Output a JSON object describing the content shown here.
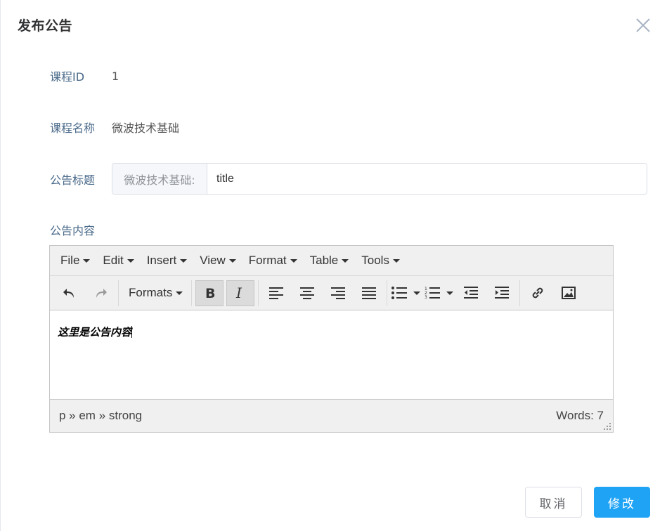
{
  "dialog": {
    "title": "发布公告",
    "close_icon": "close-icon"
  },
  "form": {
    "course_id": {
      "label": "课程ID",
      "value": "1"
    },
    "course_name": {
      "label": "课程名称",
      "value": "微波技术基础"
    },
    "notice_title": {
      "label": "公告标题",
      "prepend": "微波技术基础:",
      "value": "title"
    },
    "notice_content": {
      "label": "公告内容"
    }
  },
  "editor": {
    "menubar": [
      "File",
      "Edit",
      "Insert",
      "View",
      "Format",
      "Table",
      "Tools"
    ],
    "toolbar": {
      "formats_label": "Formats",
      "icons": [
        "undo-icon",
        "redo-icon",
        "bold-icon",
        "italic-icon",
        "align-left-icon",
        "align-center-icon",
        "align-right-icon",
        "align-justify-icon",
        "bullet-list-icon",
        "numbered-list-icon",
        "outdent-icon",
        "indent-icon",
        "link-icon",
        "image-icon"
      ],
      "active": [
        "bold",
        "italic"
      ]
    },
    "content": "这里是公告内容",
    "status_path": "p » em » strong",
    "word_count": "Words: 7"
  },
  "footer": {
    "cancel_label": "取消",
    "submit_label": "修改"
  },
  "colors": {
    "primary": "#1fa3f5",
    "label": "#4a6a8a",
    "toolbar_bg": "#f0f0f0"
  }
}
